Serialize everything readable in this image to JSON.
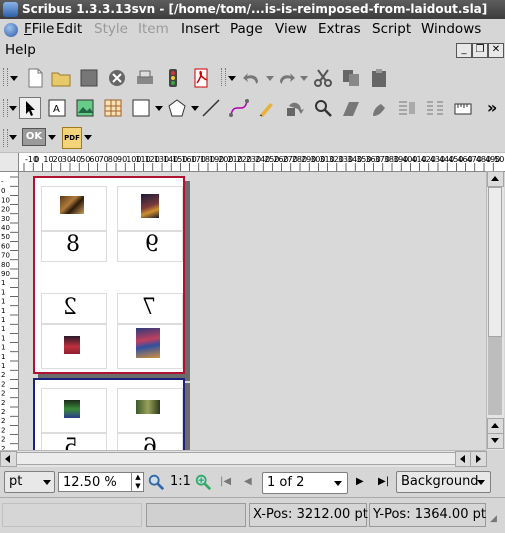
{
  "window": {
    "title": "Scribus 1.3.3.13svn - [/home/tom/...is-is-reimposed-from-laidout.sla]"
  },
  "menubar": {
    "items": [
      {
        "label": "File",
        "disabled": false
      },
      {
        "label": "Edit",
        "disabled": false
      },
      {
        "label": "Style",
        "disabled": true
      },
      {
        "label": "Item",
        "disabled": true
      },
      {
        "label": "Insert",
        "disabled": false
      },
      {
        "label": "Page",
        "disabled": false
      },
      {
        "label": "View",
        "disabled": false
      },
      {
        "label": "Extras",
        "disabled": false
      },
      {
        "label": "Script",
        "disabled": false
      },
      {
        "label": "Windows",
        "disabled": false
      }
    ],
    "help_label": "Help"
  },
  "toolbar3": {
    "ok_label": "OK",
    "pdf_label": "PDF"
  },
  "ruler": {
    "ticks": [
      "-10",
      "0",
      "10",
      "20",
      "30",
      "40",
      "50",
      "60",
      "70",
      "80",
      "90",
      "100",
      "110",
      "120",
      "130",
      "140",
      "150",
      "160",
      "170",
      "180",
      "190",
      "200",
      "210",
      "220",
      "230",
      "240",
      "250",
      "260",
      "270",
      "280",
      "290",
      "300",
      "310",
      "320",
      "330",
      "340",
      "350",
      "360",
      "370",
      "380",
      "390",
      "400",
      "410",
      "420",
      "430",
      "440",
      "450",
      "460",
      "470",
      "480",
      "490",
      "500"
    ],
    "top_prefix": "-10"
  },
  "pages": {
    "page1_numbers": [
      "8",
      "9",
      "2",
      "7"
    ],
    "page2_numbers": [
      "5",
      "6"
    ]
  },
  "zoombar": {
    "unit": "pt",
    "zoom": "12.50 %",
    "one_to_one": "1:1",
    "page_indicator": "1 of 2",
    "layer": "Background"
  },
  "statusbar": {
    "x_pos": "X-Pos: 3212.00 pt",
    "y_pos": "Y-Pos: 1364.00 pt"
  },
  "colors": {
    "page1_border": "#b0122f",
    "page2_border": "#1a237e",
    "titlebar": "#4a4a4a"
  }
}
